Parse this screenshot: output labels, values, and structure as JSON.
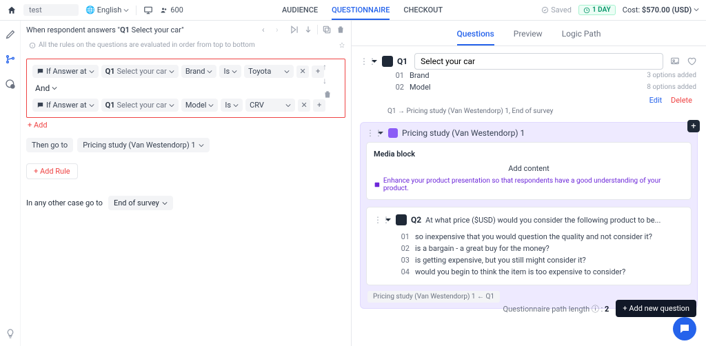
{
  "header": {
    "project": "test",
    "language": "English",
    "sample_size": "600",
    "tabs": {
      "audience": "AUDIENCE",
      "questionnaire": "QUESTIONNAIRE",
      "checkout": "CHECKOUT"
    },
    "saved": "Saved",
    "duration_badge": "1 DAY",
    "cost_label": "Cost:",
    "cost_value": "$570.00 (USD)"
  },
  "logic": {
    "heading_prefix": "When respondent answers",
    "heading_q": "Q1",
    "heading_qtitle": "Select your car",
    "info": "All the rules on the questions are evaluated in order from top to bottom",
    "rules": [
      {
        "if_label": "If Answer at",
        "q": "Q1",
        "q_title": "Select your car",
        "field": "Brand",
        "op": "Is",
        "value": "Toyota"
      },
      {
        "if_label": "If Answer at",
        "q": "Q1",
        "q_title": "Select your car",
        "field": "Model",
        "op": "Is",
        "value": "CRV"
      }
    ],
    "and": "And",
    "add": "+ Add",
    "then": "Then go to",
    "goto": "Pricing study (Van Westendorp) 1",
    "add_rule": "+ Add Rule",
    "other_label": "In any other case go to",
    "other_goto": "End of survey"
  },
  "right": {
    "tabs": {
      "questions": "Questions",
      "preview": "Preview",
      "logic": "Logic Path"
    },
    "q1": {
      "code": "Q1",
      "title": "Select your car",
      "options": [
        {
          "n": "01",
          "label": "Brand",
          "added": "3 options added"
        },
        {
          "n": "02",
          "label": "Model",
          "added": "8 options added"
        }
      ],
      "edit": "Edit",
      "delete": "Delete",
      "path": "Q1 → Pricing study (Van Westendorp) 1, End of survey"
    },
    "pricing": {
      "title": "Pricing study (Van Westendorp) 1",
      "media_block": "Media block",
      "add_content": "Add content",
      "note": "Enhance your product presentation so that respondents have a good understanding of your product."
    },
    "q2": {
      "code": "Q2",
      "title": "At what price ($USD) would you consider the following product to be...",
      "options": [
        {
          "n": "01",
          "label": "so inexpensive that you would question the quality and not consider it?"
        },
        {
          "n": "02",
          "label": "is a bargain - a great buy for the money?"
        },
        {
          "n": "03",
          "label": "is getting expensive, but you still might consider it?"
        },
        {
          "n": "04",
          "label": "would you begin to think the item is too expensive to consider?"
        }
      ]
    },
    "backpath": "Pricing study (Van Westendorp) 1 ← Q1",
    "footer": {
      "len_label": "Questionnaire path length ⓘ :",
      "len_val": "2",
      "add": "+ Add new question"
    }
  }
}
